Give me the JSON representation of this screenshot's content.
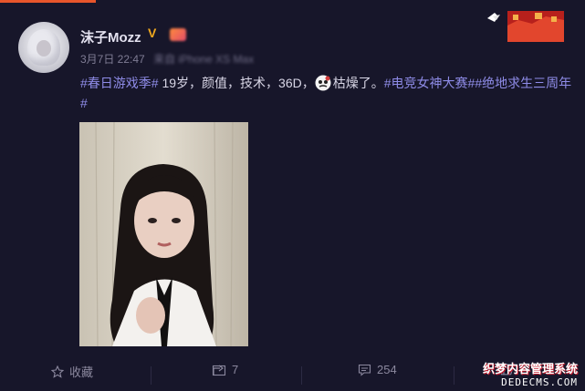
{
  "colors": {
    "background": "#17162a",
    "hashtag": "#8f8ce8",
    "accent": "#e8552b",
    "vip": "#f0a81e"
  },
  "header": {
    "username": "沫子Mozz",
    "vip_mark": "V",
    "date": "3月7日 22:47",
    "source": "来自 iPhone XS Max"
  },
  "post": {
    "segments": [
      {
        "text": "#春日游戏季#",
        "tag": true
      },
      {
        "text": " 19岁，颜值，技术，36D，",
        "tag": false
      },
      {
        "emoji": "sticker-emoji"
      },
      {
        "text": "枯燥了。",
        "tag": false
      },
      {
        "text": "#电竞女神大赛#",
        "tag": true
      },
      {
        "text": "#绝地求生三周年#",
        "tag": true
      }
    ]
  },
  "actions": {
    "favorite_label": "收藏",
    "forward_count": "7",
    "comment_count": "254",
    "like_count": ""
  },
  "watermark": {
    "line1": "织梦内容管理系统",
    "line2": "DEDECMS.COM"
  },
  "icons": [
    "star-icon",
    "forward-icon",
    "comment-icon",
    "like-icon",
    "great-wall-decoration"
  ]
}
